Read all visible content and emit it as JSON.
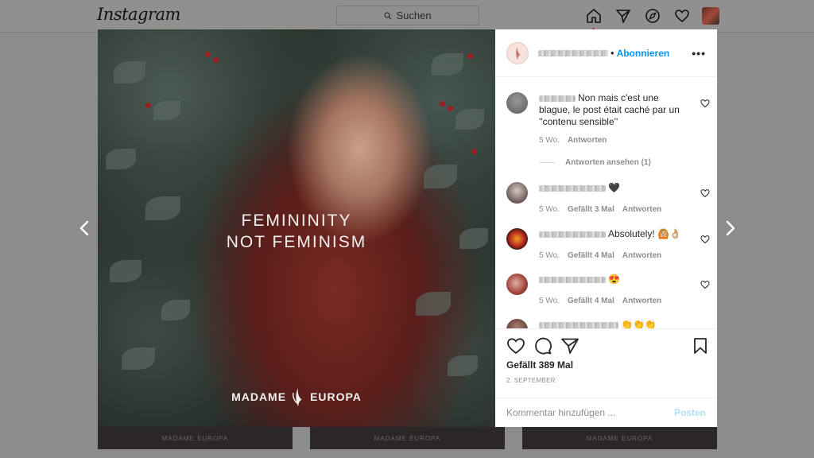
{
  "header": {
    "logo": "Instagram",
    "search_placeholder": "Suchen",
    "icons": [
      "home-icon",
      "direct-icon",
      "explore-icon",
      "activity-heart-icon",
      "profile-avatar"
    ]
  },
  "post": {
    "headline_line1": "FEMININITY",
    "headline_line2": "NOT FEMINISM",
    "brand_left": "MADAME",
    "brand_right": "EUROPA"
  },
  "background_thumbs": [
    "MADAME EUROPA",
    "MADAME EUROPA",
    "MADAME EUROPA"
  ],
  "panel": {
    "dot": "•",
    "follow_label": "Abonnieren",
    "more_label": "•••",
    "comments": [
      {
        "text": "Non mais c'est une blague, le post était caché par un ''contenu sensible''",
        "time": "5 Wo.",
        "likes": "",
        "reply": "Antworten"
      },
      {
        "text": "🖤",
        "time": "5 Wo.",
        "likes": "Gefällt 3 Mal",
        "reply": "Antworten"
      },
      {
        "text": "Absolutely! 🙆🏼👌🏼",
        "time": "5 Wo.",
        "likes": "Gefällt 4 Mal",
        "reply": "Antworten"
      },
      {
        "text": "😍",
        "time": "5 Wo.",
        "likes": "Gefällt 4 Mal",
        "reply": "Antworten"
      },
      {
        "text": "👏👏👏",
        "time": "",
        "likes": "",
        "reply": ""
      }
    ],
    "view_replies": "Antworten ansehen (1)",
    "likes_total": "Gefällt 389 Mal",
    "date": "2. SEPTEMBER",
    "add_comment_placeholder": "Kommentar hinzufügen ...",
    "post_label": "Posten"
  },
  "colors": {
    "accent_blue": "#0095f6",
    "post_disabled": "#b2dffc",
    "overlay": "#8c8c8c"
  }
}
